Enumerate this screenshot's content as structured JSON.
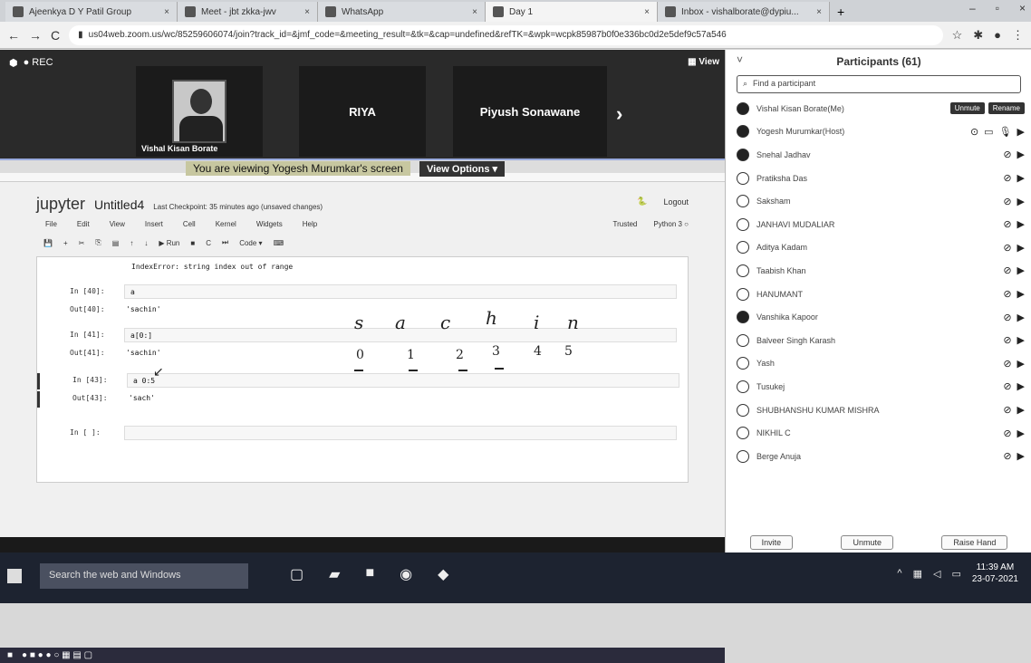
{
  "browser": {
    "tabs": [
      {
        "label": "Ajeenkya D Y Patil Group",
        "active": false
      },
      {
        "label": "Meet - jbt zkka-jwv",
        "active": false
      },
      {
        "label": "WhatsApp",
        "active": false
      },
      {
        "label": "Day 1",
        "active": true
      },
      {
        "label": "Inbox - vishalborate@dypiu...",
        "active": false
      }
    ],
    "url": "us04web.zoom.us/wc/85259606074/join?track_id=&jmf_code=&meeting_result=&tk=&cap=undefined&refTK=&wpk=wcpk85987b0f0e336bc0d2e5def9c57a546"
  },
  "meeting": {
    "tiles": [
      {
        "name": "Vishal Kisan Borate",
        "center_text": ""
      },
      {
        "name": "",
        "center_text": "RIYA"
      },
      {
        "name": "",
        "center_text": "Piyush Sonawane"
      }
    ],
    "view_label": "View",
    "viewing_label": "You are viewing Yogesh Murumkar's screen",
    "view_options_label": "View Options"
  },
  "jupyter": {
    "logo_text": "jupyter",
    "title": "Untitled4",
    "checkpoint": "Last Checkpoint: 35 minutes ago (unsaved changes)",
    "logout": "Logout",
    "menu": [
      "File",
      "Edit",
      "View",
      "Insert",
      "Cell",
      "Kernel",
      "Widgets",
      "Help"
    ],
    "trusted": "Trusted",
    "kernel": "Python 3",
    "toolbar_run": "Run",
    "cell_type": "Code",
    "error_line": "IndexError: string index out of range",
    "cells": [
      {
        "prompt": "In [40]:",
        "code": "a",
        "out_prompt": "Out[40]:",
        "out": "'sachin'"
      },
      {
        "prompt": "In [41]:",
        "code": "a[0:]",
        "out_prompt": "Out[41]:",
        "out": "'sachin'"
      },
      {
        "prompt": "In [43]:",
        "code": "a 0:5",
        "out_prompt": "Out[43]:",
        "out": "'sach'"
      },
      {
        "prompt": "In [ ]:",
        "code": "",
        "out_prompt": "",
        "out": ""
      }
    ],
    "handwriting_letters": [
      "s",
      "a",
      "c",
      "h",
      "i",
      "n"
    ],
    "handwriting_digits": [
      "0",
      "1",
      "2",
      "3",
      "4",
      "5"
    ]
  },
  "participants": {
    "title": "Participants (61)",
    "search_placeholder": "Find a participant",
    "unmute_btn": "Unmute",
    "rename_btn": "Rename",
    "list": [
      "Vishal Kisan Borate(Me)",
      "Yogesh Murumkar(Host)",
      "Snehal Jadhav",
      "Pratiksha Das",
      "Saksham",
      "JANHAVI MUDALIAR",
      "Aditya Kadam",
      "Taabish Khan",
      "HANUMANT",
      "Vanshika Kapoor",
      "Balveer Singh Karash",
      "Yash",
      "Tusukej",
      "SHUBHANSHU KUMAR MISHRA",
      "NIKHIL C",
      "Berge Anuja"
    ],
    "footer": {
      "invite": "Invite",
      "unmute": "Unmute",
      "raise_hand": "Raise Hand"
    }
  },
  "taskbar": {
    "search_text": "Search the web and Windows",
    "time": "11:39 AM",
    "date": "23-07-2021"
  }
}
